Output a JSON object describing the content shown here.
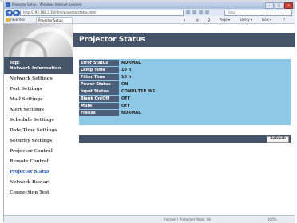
{
  "window": {
    "title": "Projector Setup - Windows Internet Explorer",
    "minimize": "–",
    "maximize": "□",
    "close": "x"
  },
  "addressbar": {
    "back": "◀",
    "forward": "▶",
    "url": "http://192.168.1.10/html/projectorstatus.html",
    "search_placeholder": "Bing"
  },
  "favbar": {
    "favorites": "Favorites",
    "tab": "Projector Setup",
    "page_menu": "Page ▾",
    "safety_menu": "Safety ▾",
    "tools_menu": "Tools ▾"
  },
  "sidebar": {
    "top_item": [
      "Top:",
      "Network Information"
    ],
    "items": [
      {
        "label": "Network Settings",
        "active": false
      },
      {
        "label": "Port Settings",
        "active": false
      },
      {
        "label": "Mail Settings",
        "active": false
      },
      {
        "label": "Alert Settings",
        "active": false
      },
      {
        "label": "Schedule Settings",
        "active": false
      },
      {
        "label": "Date/Time Settings",
        "active": false
      },
      {
        "label": "Security Settings",
        "active": false
      },
      {
        "label": "Projector Control",
        "active": false
      },
      {
        "label": "Remote Control",
        "active": false
      },
      {
        "label": "Projector Status",
        "active": true
      },
      {
        "label": "Network Restart",
        "active": false
      },
      {
        "label": "Connection Test",
        "active": false
      }
    ]
  },
  "main": {
    "title": "Projector Status",
    "status_rows": [
      {
        "key": "Error Status",
        "value": "NORMAL"
      },
      {
        "key": "Lamp Time",
        "value": "10 h"
      },
      {
        "key": "Filter Time",
        "value": "10 h"
      },
      {
        "key": "Power Status",
        "value": "ON"
      },
      {
        "key": "Input Status",
        "value": "COMPUTER IN1"
      },
      {
        "key": "Blank On/Off",
        "value": "OFF"
      },
      {
        "key": "Mute",
        "value": "OFF"
      },
      {
        "key": "Freeze",
        "value": "NORMAL"
      }
    ],
    "refresh_label": "Refresh"
  },
  "statusbar": {
    "zone": "Internet | Protected Mode: On",
    "zoom": "100%"
  },
  "colors": {
    "header_bg": "#46546a",
    "panel_bg": "#8ec9e8",
    "key_bg": "#4c5e78",
    "active_link": "#1f4fa8"
  }
}
